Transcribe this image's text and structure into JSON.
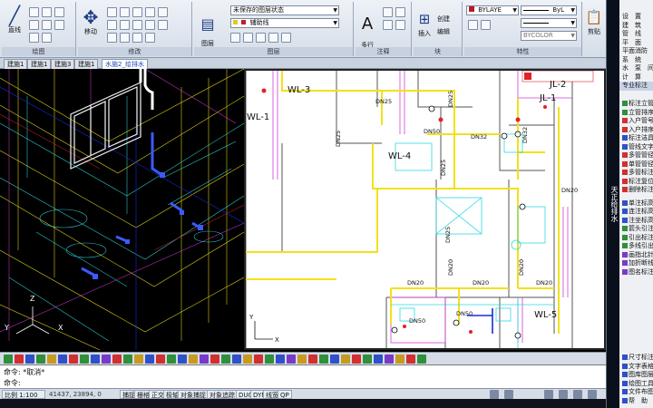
{
  "ribbon": {
    "draw_panel": {
      "title": "绘图",
      "line_label": "直线"
    },
    "modify_panel": {
      "title": "修改",
      "move_label": "移动"
    },
    "layers_panel": {
      "title": "图层",
      "props_label": "图层\n特性",
      "layer_state": "未保存的图层状态",
      "current_layer": "辅助线"
    },
    "annotation_panel": {
      "title": "注释",
      "text_label": "多行\n文字"
    },
    "block_panel": {
      "title": "块",
      "insert_label": "插入",
      "create_label": "创建",
      "edit_label": "编辑"
    },
    "props_panel": {
      "title": "特性",
      "color": "BYLAYE",
      "lineweight": "ByL",
      "color2": "BYCOLOR"
    },
    "extra_label": "剪贴"
  },
  "tabs": [
    {
      "label": "建施1"
    },
    {
      "label": "建施1"
    },
    {
      "label": "建施3"
    },
    {
      "label": "建施1"
    },
    {
      "label": "水施2_给排水"
    }
  ],
  "viewport_left": {
    "axis_y": "Y",
    "axis_x": "X",
    "axis_z": "Z"
  },
  "viewport_right": {
    "labels": {
      "wl3": "WL-3",
      "wl1": "WL-1",
      "wl4": "WL-4",
      "wl5": "WL-5",
      "jl1": "JL-1",
      "jl2": "JL-2",
      "dn25a": "DN25",
      "dn25b": "DN25",
      "dn25c": "DN25",
      "dn25d": "DN25",
      "dn25e": "DN25",
      "dn20a": "DN20",
      "dn20b": "DN20",
      "dn20c": "DN20",
      "dn20d": "DN20",
      "dn20e": "DN20",
      "dn20f": "DN20",
      "dn32": "DN32",
      "dn50a": "DN50",
      "dn50b": "DN50",
      "dn50c": "DN50",
      "dn32b": "DN32"
    },
    "axis_y": "Y",
    "axis_x": "X"
  },
  "command": {
    "history": "命令: *取消*",
    "prompt": "命令:"
  },
  "status": {
    "scale": "比例 1:100",
    "coords": "41437, 23894, 0",
    "toggles": [
      "捕捉",
      "栅格",
      "正交",
      "极轴",
      "对象捕捉",
      "对象追踪",
      "DUCS",
      "DYN",
      "线宽",
      "QP"
    ]
  },
  "right_menu": {
    "vertical_title": "天正给排水",
    "top_items": [
      "设　置",
      "建　筑",
      "管　线",
      "平　面",
      "平面消防",
      "系　统",
      "水　泵　间",
      "计　算"
    ],
    "section": "专业标注",
    "items": [
      "标注立管",
      "立管排序",
      "入户管号",
      "入户排序",
      "标注洁具",
      "管线文字",
      "多管管径",
      "单管管径",
      "多管标注",
      "标注复位",
      "删除标注",
      "单注标高",
      "连注标高",
      "注坐标高",
      "箭头引注",
      "引出标注",
      "多线引出",
      "画指北针",
      "加折断线",
      "图名标注"
    ],
    "bottom_items": [
      "尺寸标注",
      "文字表格",
      "图库图层",
      "绘图工具",
      "文件布图",
      "帮　助"
    ]
  },
  "colors": {
    "cad_yellow": "#f2e11a",
    "cad_cyan": "#2fd8e0",
    "cad_red": "#e0222a",
    "cad_blue": "#1a2ad8",
    "cad_magenta": "#d23cd8",
    "cad_green": "#28b032"
  }
}
